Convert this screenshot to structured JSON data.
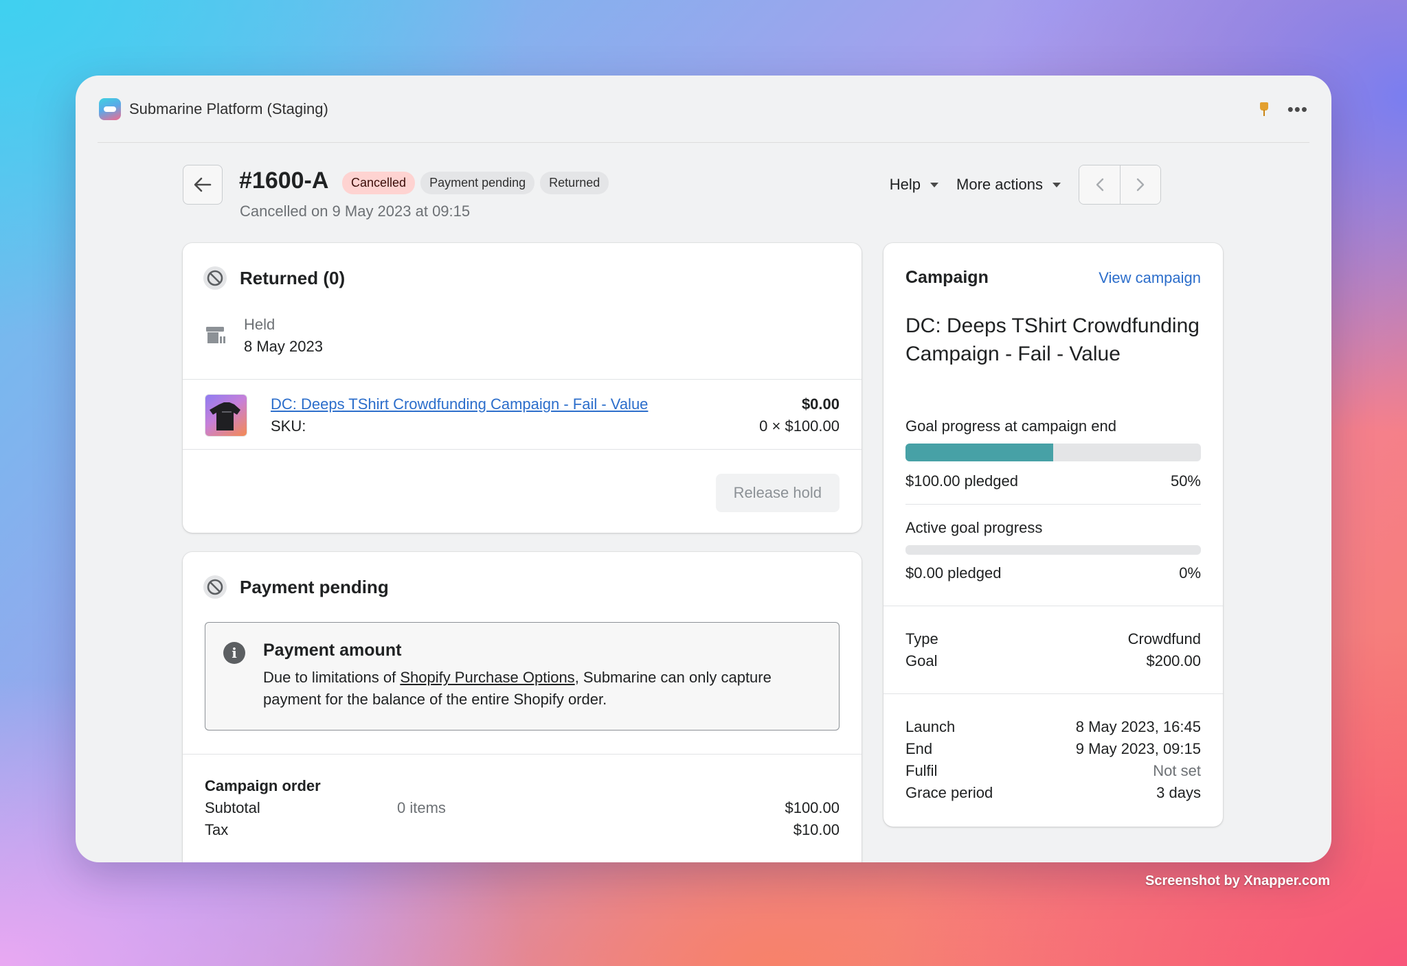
{
  "app": {
    "title": "Submarine Platform (Staging)"
  },
  "header": {
    "order_id": "#1600-A",
    "badges": [
      "Cancelled",
      "Payment pending",
      "Returned"
    ],
    "subtitle": "Cancelled on 9 May 2023 at 09:15",
    "help_label": "Help",
    "more_actions_label": "More actions"
  },
  "returned_card": {
    "title": "Returned (0)",
    "held_label": "Held",
    "held_date": "8 May 2023",
    "item": {
      "name": "DC: Deeps TShirt Crowdfunding Campaign - Fail - Value",
      "sku_label": "SKU:",
      "total": "$0.00",
      "qty_price": "0 × $100.00"
    },
    "release_button": "Release hold"
  },
  "payment_card": {
    "title": "Payment pending",
    "notice_title": "Payment amount",
    "notice_text_1": "Due to limitations of ",
    "notice_link": "Shopify Purchase Options",
    "notice_text_2": ", Submarine can only capture payment for the balance of the entire Shopify order.",
    "order_title": "Campaign order",
    "rows": [
      {
        "label": "Subtotal",
        "items": "0 items",
        "value": "$100.00"
      },
      {
        "label": "Tax",
        "items": "",
        "value": "$10.00"
      }
    ]
  },
  "campaign_card": {
    "title": "Campaign",
    "view_link": "View campaign",
    "name": "DC: Deeps TShirt Crowdfunding Campaign - Fail - Value",
    "goal_end_label": "Goal progress at campaign end",
    "goal_end_pledged": "$100.00 pledged",
    "goal_end_percent": "50%",
    "goal_end_fraction": 0.5,
    "active_label": "Active goal progress",
    "active_pledged": "$0.00 pledged",
    "active_percent": "0%",
    "active_fraction": 0,
    "details_1": [
      {
        "label": "Type",
        "value": "Crowdfund"
      },
      {
        "label": "Goal",
        "value": "$200.00"
      }
    ],
    "details_2": [
      {
        "label": "Launch",
        "value": "8 May 2023, 16:45"
      },
      {
        "label": "End",
        "value": "9 May 2023, 09:15"
      },
      {
        "label": "Fulfil",
        "value": "Not set"
      },
      {
        "label": "Grace period",
        "value": "3 days"
      }
    ]
  },
  "colors": {
    "progress_fill": "#47a1a6",
    "link": "#2c6ecb",
    "cancelled_badge": "#fed3d1"
  },
  "watermark": "Screenshot by Xnapper.com"
}
